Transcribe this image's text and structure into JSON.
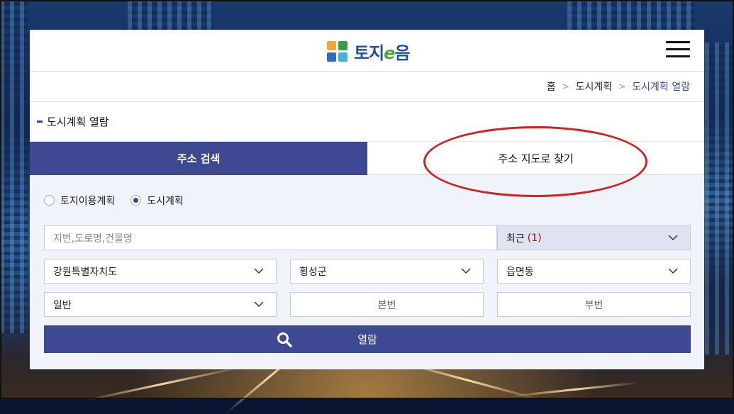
{
  "header": {
    "logo_text_a": "토지",
    "logo_text_e": "e",
    "logo_text_b": "음",
    "menu_icon": "hamburger-menu-icon"
  },
  "breadcrumb": {
    "items": [
      "홈",
      "도시계획",
      "도시계획 열람"
    ]
  },
  "page_title": "도시계획 열람",
  "tabs": [
    {
      "label": "주소 검색",
      "active": true
    },
    {
      "label": "주소 지도로 찾기",
      "active": false
    }
  ],
  "plan_type": {
    "options": [
      "토지이용계획",
      "도시계획"
    ],
    "selected": "도시계획"
  },
  "search": {
    "placeholder": "지번,도로명,건물명",
    "recent_label": "최근",
    "recent_count": "(1)"
  },
  "address": {
    "sido": "강원특별자치도",
    "sigungu": "횡성군",
    "eupmyeondong": "읍면동"
  },
  "lot": {
    "type": "일반",
    "main_number_placeholder": "본번",
    "sub_number_placeholder": "부번"
  },
  "view_button": {
    "label": "열람",
    "icon": "search-icon"
  },
  "colors": {
    "primary": "#3f4992",
    "highlight_ellipse": "#d1201f",
    "recent_count": "#c00000"
  }
}
